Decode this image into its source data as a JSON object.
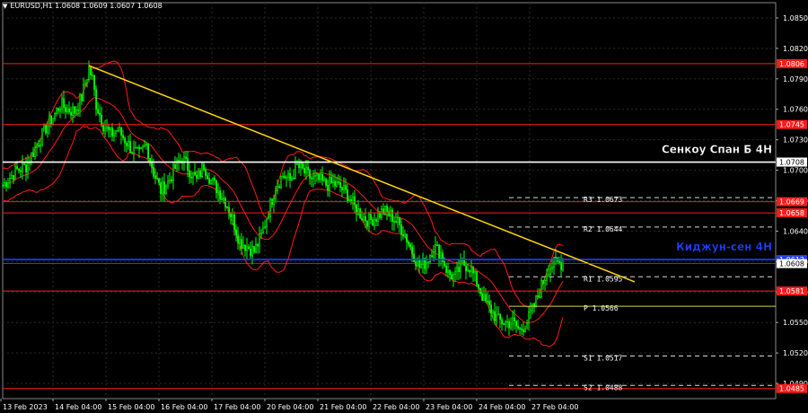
{
  "header": {
    "symbol_line": "EURUSD,H1  1.0608 1.0609 1.0607 1.0608"
  },
  "colors": {
    "background": "#000000",
    "grid": "#2a2a2a",
    "bull_candle": "#00ff00",
    "bear_candle": "#00ff00",
    "bollinger": "#ff1a1a",
    "trendline": "#ffd700",
    "resistance": "#ff1a1a",
    "senkou": "#ffffff",
    "kijun": "#1e40ff",
    "pivot_dashes": "#d9d9d9",
    "pivot_p": "#d4d45a"
  },
  "chart_data": {
    "type": "line",
    "title": "EURUSD,H1",
    "ylim": [
      1.0475,
      1.0865
    ],
    "y_ticks": [
      "1.0850",
      "1.0820",
      "1.0790",
      "1.0760",
      "1.0730",
      "1.0700",
      "1.0670",
      "1.0640",
      "1.0610",
      "1.0580",
      "1.0550",
      "1.0520",
      "1.0490"
    ],
    "x_ticks": [
      "13 Feb 2023",
      "14 Feb 04:00",
      "15 Feb 04:00",
      "16 Feb 04:00",
      "17 Feb 04:00",
      "20 Feb 04:00",
      "21 Feb 04:00",
      "22 Feb 04:00",
      "23 Feb 04:00",
      "24 Feb 04:00",
      "27 Feb 04:00"
    ],
    "grid": true,
    "price_path": [
      [
        0,
        1.0685
      ],
      [
        4,
        1.0693
      ],
      [
        8,
        1.07
      ],
      [
        13,
        1.0704
      ],
      [
        16,
        1.0715
      ],
      [
        20,
        1.0728
      ],
      [
        24,
        1.0742
      ],
      [
        28,
        1.0752
      ],
      [
        32,
        1.0765
      ],
      [
        36,
        1.076
      ],
      [
        40,
        1.0758
      ],
      [
        44,
        1.0772
      ],
      [
        48,
        1.08
      ],
      [
        50,
        1.079
      ],
      [
        52,
        1.0765
      ],
      [
        56,
        1.0745
      ],
      [
        60,
        1.0735
      ],
      [
        64,
        1.074
      ],
      [
        68,
        1.073
      ],
      [
        72,
        1.072
      ],
      [
        76,
        1.0715
      ],
      [
        80,
        1.0725
      ],
      [
        84,
        1.0698
      ],
      [
        88,
        1.068
      ],
      [
        92,
        1.0688
      ],
      [
        96,
        1.0702
      ],
      [
        100,
        1.0712
      ],
      [
        104,
        1.07
      ],
      [
        108,
        1.069
      ],
      [
        112,
        1.0705
      ],
      [
        116,
        1.069
      ],
      [
        120,
        1.068
      ],
      [
        124,
        1.067
      ],
      [
        128,
        1.0652
      ],
      [
        132,
        1.063
      ],
      [
        136,
        1.0625
      ],
      [
        140,
        1.062
      ],
      [
        144,
        1.0635
      ],
      [
        148,
        1.066
      ],
      [
        152,
        1.0684
      ],
      [
        156,
        1.0695
      ],
      [
        160,
        1.069
      ],
      [
        164,
        1.0704
      ],
      [
        168,
        1.0698
      ],
      [
        172,
        1.0692
      ],
      [
        176,
        1.069
      ],
      [
        180,
        1.0686
      ],
      [
        184,
        1.0687
      ],
      [
        188,
        1.0683
      ],
      [
        192,
        1.0676
      ],
      [
        196,
        1.0664
      ],
      [
        200,
        1.0655
      ],
      [
        204,
        1.065
      ],
      [
        208,
        1.0654
      ],
      [
        212,
        1.066
      ],
      [
        216,
        1.0656
      ],
      [
        220,
        1.0648
      ],
      [
        224,
        1.0637
      ],
      [
        228,
        1.062
      ],
      [
        232,
        1.0605
      ],
      [
        236,
        1.061
      ],
      [
        240,
        1.0625
      ],
      [
        244,
        1.0618
      ],
      [
        248,
        1.0598
      ],
      [
        252,
        1.0595
      ],
      [
        256,
        1.0608
      ],
      [
        260,
        1.0605
      ],
      [
        264,
        1.059
      ],
      [
        268,
        1.0572
      ],
      [
        272,
        1.0562
      ],
      [
        276,
        1.0552
      ],
      [
        280,
        1.055
      ],
      [
        284,
        1.055
      ],
      [
        288,
        1.0542
      ],
      [
        292,
        1.0551
      ],
      [
        296,
        1.0566
      ],
      [
        300,
        1.0586
      ],
      [
        304,
        1.0604
      ],
      [
        308,
        1.0609
      ],
      [
        312,
        1.0608
      ]
    ],
    "trendline": {
      "label": "",
      "from": [
        48,
        1.0803
      ],
      "to": [
        352,
        1.059
      ]
    },
    "horizontal_levels": [
      {
        "name": "",
        "value": 1.0805,
        "color": "#ff1a1a",
        "tag": "1.0806",
        "style": "solid"
      },
      {
        "name": "",
        "value": 1.0745,
        "color": "#ff1a1a",
        "tag": "1.0745",
        "style": "solid"
      },
      {
        "name": "Сенкоу Спан Б 4Н",
        "value": 1.0708,
        "color": "#ffffff",
        "tag": "1.0708",
        "style": "solid"
      },
      {
        "name": "",
        "value": 1.0669,
        "color": "#ff1a1a",
        "tag": "1.0669",
        "style": "solid"
      },
      {
        "name": "",
        "value": 1.0658,
        "color": "#ff1a1a",
        "tag": "1.0658",
        "style": "solid"
      },
      {
        "name": "Киджун-сен 4Н",
        "value": 1.0612,
        "color": "#1e40ff",
        "tag": "1.0612",
        "style": "solid"
      },
      {
        "name": "",
        "value": 1.0581,
        "color": "#ff1a1a",
        "tag": "1.0581",
        "style": "solid"
      },
      {
        "name": "",
        "value": 1.0485,
        "color": "#ff1a1a",
        "tag": "1.0485",
        "style": "solid"
      }
    ],
    "pivots": [
      {
        "name": "R3",
        "value": 1.0673,
        "label": "R3  1.0673"
      },
      {
        "name": "R2",
        "value": 1.0644,
        "label": "R2  1.0644"
      },
      {
        "name": "R1",
        "value": 1.0595,
        "label": "R1  1.0595"
      },
      {
        "name": "P",
        "value": 1.0566,
        "label": "P  1.0566"
      },
      {
        "name": "S1",
        "value": 1.0517,
        "label": "S1  1.0517"
      },
      {
        "name": "S2",
        "value": 1.0488,
        "label": "S2  1.0488"
      }
    ],
    "current_price": {
      "value": 1.0608,
      "tag": "1.0608"
    }
  }
}
